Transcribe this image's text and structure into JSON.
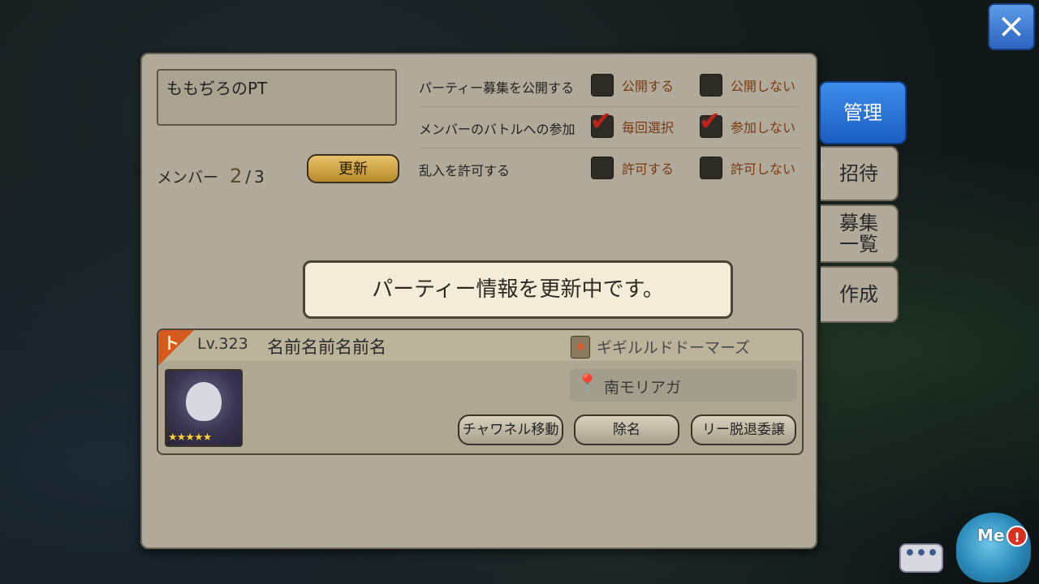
{
  "party": {
    "name": "ももぢろのPT",
    "members_label": "メンバー",
    "members_count": "2",
    "members_sep": "/",
    "members_max": "3",
    "update_button": "更新"
  },
  "settings": [
    {
      "label": "パーティー募集を公開する",
      "opt1": "公開する",
      "opt1_checked": false,
      "opt2": "公開しない",
      "opt2_checked": false
    },
    {
      "label": "メンバーのバトルへの参加",
      "opt1": "毎回選択",
      "opt1_checked": true,
      "opt2": "参加しない",
      "opt2_checked": true
    },
    {
      "label": "乱入を許可する",
      "opt1": "許可する",
      "opt1_checked": false,
      "opt2": "許可しない",
      "opt2_checked": false
    }
  ],
  "toast": "パーティー情報を更新中です。",
  "member": {
    "level": "Lv.323",
    "name": "名前名前名前名",
    "guild": "ギギルルドドーマーズ",
    "location": "南モリアガ",
    "stars": "★★★★★",
    "buttons": {
      "channel": "チャワネル移動",
      "remove": "除名",
      "transfer": "リー脱退委譲"
    }
  },
  "tabs": {
    "manage": "管理",
    "invite": "招待",
    "recruit": "募集\n一覧",
    "create": "作成"
  },
  "overlay": {
    "close_icon": "×",
    "chat_icon": "•••",
    "mascot_label": "Me",
    "badge": "!"
  },
  "colors": {
    "panel": "#b1aa9a",
    "active_tab": "#2c6fd4",
    "update_button": "#d4a848",
    "check": "#c0221a"
  }
}
